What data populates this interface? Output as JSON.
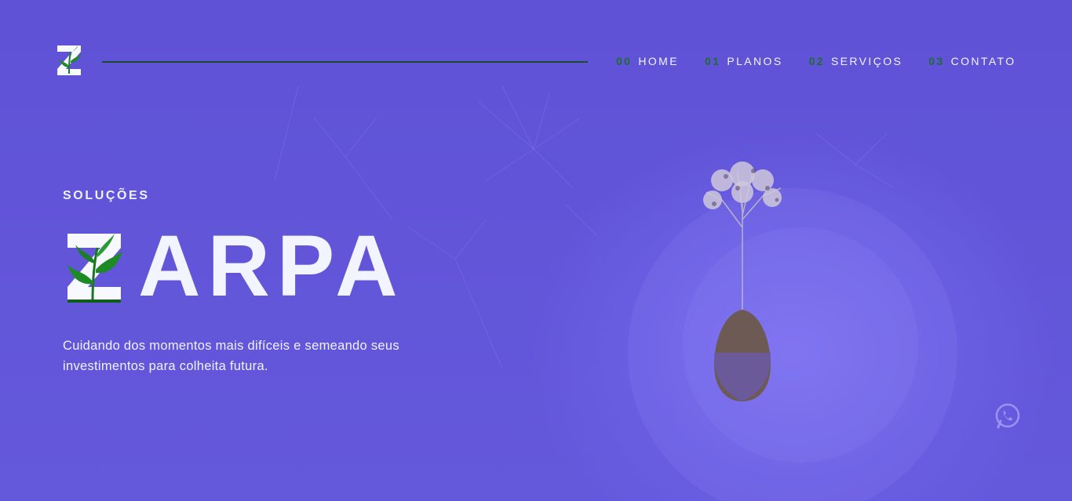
{
  "header": {
    "logo_icon": "zarpa-z-leaf-logo",
    "nav": [
      {
        "num": "00",
        "label": "HOME"
      },
      {
        "num": "01",
        "label": "PLANOS"
      },
      {
        "num": "02",
        "label": "SERVIÇOS"
      },
      {
        "num": "03",
        "label": "CONTATO"
      }
    ]
  },
  "hero": {
    "kicker": "SOLUÇÕES",
    "brand_text": "ARPA",
    "brand_icon": "z-leaf-icon",
    "tagline_line1": "Cuidando dos momentos mais difíceis e semeando seus",
    "tagline_line2": "investimentos para colheita futura.",
    "image": "tree-seed-pod-illustration"
  },
  "floating": {
    "icon": "whatsapp-icon"
  },
  "colors": {
    "background": "#5f52d6",
    "accent_green": "#1f6b34",
    "text": "#eef2ff"
  }
}
